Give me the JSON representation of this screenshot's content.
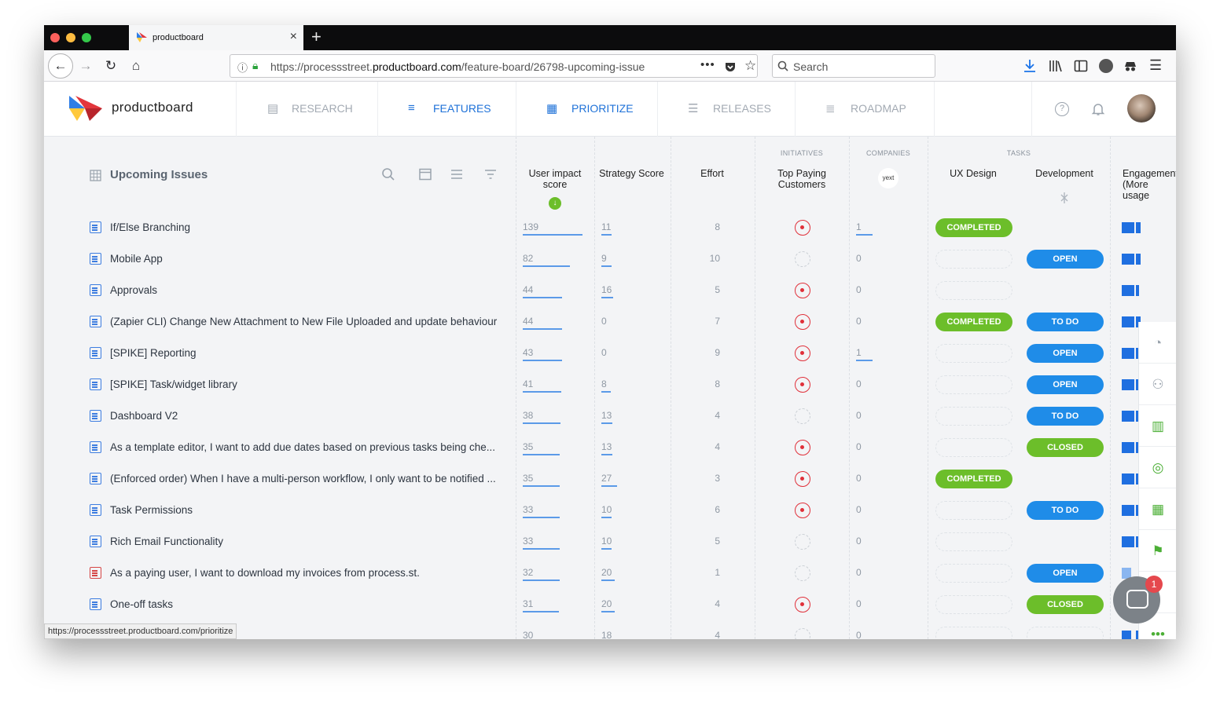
{
  "browser": {
    "tab_title": "productboard",
    "url_prefix": "https://processstreet.",
    "url_domain": "productboard.com",
    "url_path": "/feature-board/26798-upcoming-issue",
    "search_placeholder": "Search",
    "status_url": "https://processstreet.productboard.com/prioritize"
  },
  "app": {
    "logo_text": "productboard",
    "nav": [
      {
        "label": "RESEARCH",
        "active": false
      },
      {
        "label": "FEATURES",
        "active": true
      },
      {
        "label": "PRIORITIZE",
        "active": true
      },
      {
        "label": "RELEASES",
        "active": false
      },
      {
        "label": "ROADMAP",
        "active": false
      }
    ]
  },
  "board": {
    "title": "Upcoming Issues",
    "groups": {
      "initiatives": "INITIATIVES",
      "companies": "COMPANIES",
      "tasks": "TASKS"
    },
    "columns": {
      "impact": "User impact score",
      "strategy": "Strategy Score",
      "effort": "Effort",
      "top_paying": "Top Paying Customers",
      "company_logo": "yext",
      "ux": "UX Design",
      "dev": "Development",
      "engagement": "Engagement (More usage"
    }
  },
  "rows": [
    {
      "title": "If/Else Branching",
      "icon": "blue",
      "impact": "139",
      "strategy": "11",
      "effort": "8",
      "initiative": true,
      "company": "1",
      "ux": "COMPLETED",
      "dev": ""
    },
    {
      "title": "Mobile App",
      "icon": "blue",
      "impact": "82",
      "strategy": "9",
      "effort": "10",
      "initiative": false,
      "company": "0",
      "ux": "",
      "dev": "OPEN"
    },
    {
      "title": "Approvals",
      "icon": "blue",
      "impact": "44",
      "strategy": "16",
      "effort": "5",
      "initiative": true,
      "company": "0",
      "ux": "",
      "dev": ""
    },
    {
      "title": "(Zapier CLI) Change New Attachment to New File Uploaded and update behaviour",
      "icon": "blue",
      "impact": "44",
      "strategy": "0",
      "effort": "7",
      "initiative": true,
      "company": "0",
      "ux": "COMPLETED",
      "dev": "TO DO"
    },
    {
      "title": "[SPIKE] Reporting",
      "icon": "blue",
      "impact": "43",
      "strategy": "0",
      "effort": "9",
      "initiative": true,
      "company": "1",
      "ux": "",
      "dev": "OPEN"
    },
    {
      "title": "[SPIKE] Task/widget library",
      "icon": "blue",
      "impact": "41",
      "strategy": "8",
      "effort": "8",
      "initiative": true,
      "company": "0",
      "ux": "",
      "dev": "OPEN"
    },
    {
      "title": "Dashboard V2",
      "icon": "blue",
      "impact": "38",
      "strategy": "13",
      "effort": "4",
      "initiative": false,
      "company": "0",
      "ux": "",
      "dev": "TO DO"
    },
    {
      "title": "As a template editor, I want to add due dates based on previous tasks being che...",
      "icon": "blue",
      "impact": "35",
      "strategy": "13",
      "effort": "4",
      "initiative": true,
      "company": "0",
      "ux": "",
      "dev": "CLOSED"
    },
    {
      "title": "(Enforced order) When I have a multi-person workflow, I only want to be notified ...",
      "icon": "blue",
      "impact": "35",
      "strategy": "27",
      "effort": "3",
      "initiative": true,
      "company": "0",
      "ux": "COMPLETED",
      "dev": ""
    },
    {
      "title": "Task Permissions",
      "icon": "blue",
      "impact": "33",
      "strategy": "10",
      "effort": "6",
      "initiative": true,
      "company": "0",
      "ux": "",
      "dev": "TO DO"
    },
    {
      "title": "Rich Email Functionality",
      "icon": "blue",
      "impact": "33",
      "strategy": "10",
      "effort": "5",
      "initiative": false,
      "company": "0",
      "ux": "",
      "dev": ""
    },
    {
      "title": "As a paying user, I want to download my invoices from process.st.",
      "icon": "red",
      "impact": "32",
      "strategy": "20",
      "effort": "1",
      "initiative": false,
      "company": "0",
      "ux": "",
      "dev": "OPEN"
    },
    {
      "title": "One-off tasks",
      "icon": "blue",
      "impact": "31",
      "strategy": "20",
      "effort": "4",
      "initiative": true,
      "company": "0",
      "ux": "",
      "dev": "CLOSED"
    },
    {
      "title": "",
      "icon": "none",
      "impact": "30",
      "strategy": "18",
      "effort": "4",
      "initiative": false,
      "company": "0",
      "ux": "",
      "dev": ""
    }
  ],
  "chat_badge": "1",
  "colors": {
    "accent_blue": "#1f8ce8",
    "accent_green": "#6cbe2a",
    "alert_red": "#e0303a"
  }
}
